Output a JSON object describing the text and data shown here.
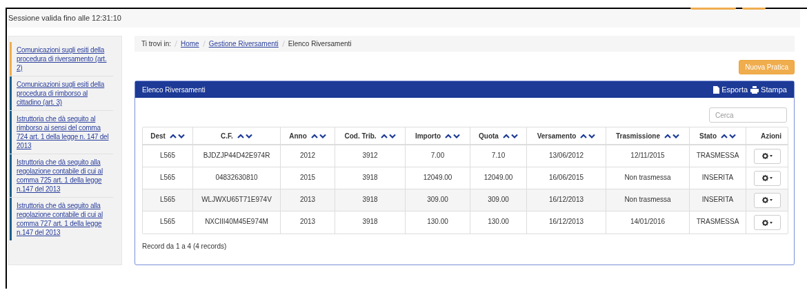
{
  "header": {
    "session": "Sessione valida fino alle 12:31:10"
  },
  "sidebar": {
    "items": [
      {
        "label": "Comunicazioni sugli esiti della procedura di riversamento (art. 2)",
        "selected": true
      },
      {
        "label": "Comunicazioni sugli esiti della procedura di rimborso al cittadino (art. 3)",
        "selected": false
      },
      {
        "label": "Istruttoria che dà seguito al rimborso ai sensi del comma 724 art. 1 della legge n. 147 del 2013",
        "selected": false
      },
      {
        "label": "Istruttoria che dà seguito alla regolazione contabile di cui al comma 725 art. 1 della legge n.147 del 2013",
        "selected": false
      },
      {
        "label": "Istruttoria che dà seguito alla regolazione contabile di cui al comma 727 art. 1 della legge n.147 del 2013",
        "selected": false
      }
    ]
  },
  "breadcrumb": {
    "prefix": "Ti trovi in:",
    "items": [
      {
        "label": "Home",
        "kind": "link"
      },
      {
        "label": "Gestione Riversamenti",
        "kind": "link"
      },
      {
        "label": "Elenco Riversamenti",
        "kind": "current"
      }
    ]
  },
  "new_button": "Nuova Pratica",
  "panel": {
    "title": "Elenco Riversamenti",
    "actions": [
      {
        "label": "Esporta",
        "kind": "export"
      },
      {
        "label": "Stampa",
        "kind": "print"
      }
    ],
    "search": {
      "placeholder": "Cerca"
    },
    "table": {
      "columns": [
        {
          "label": "Dest",
          "sortable": true
        },
        {
          "label": "C.F.",
          "sortable": true
        },
        {
          "label": "Anno",
          "sortable": true
        },
        {
          "label": "Cod. Trib.",
          "sortable": true
        },
        {
          "label": "Importo",
          "sortable": true
        },
        {
          "label": "Quota",
          "sortable": true
        },
        {
          "label": "Versamento",
          "sortable": true
        },
        {
          "label": "Trasmissione",
          "sortable": true
        },
        {
          "label": "Stato",
          "sortable": true
        },
        {
          "label": "Azioni",
          "sortable": false
        }
      ],
      "rows": [
        {
          "cells": [
            "L565",
            "BJDZJP44D42E974R",
            "2012",
            "3912",
            "7.00",
            "7.10",
            "13/06/2012",
            "12/11/2015",
            "TRASMESSA"
          ]
        },
        {
          "cells": [
            "L565",
            "04832630810",
            "2015",
            "3918",
            "12049.00",
            "12049.00",
            "16/06/2015",
            "Non trasmessa",
            "INSERITA"
          ]
        },
        {
          "cells": [
            "L565",
            "WLJWXU65T71E974V",
            "2013",
            "3918",
            "309.00",
            "309.00",
            "16/12/2013",
            "Non trasmessa",
            "INSERITA"
          ]
        },
        {
          "cells": [
            "L565",
            "NXCIII40M45E974M",
            "2013",
            "3918",
            "130.00",
            "130.00",
            "16/12/2013",
            "14/01/2016",
            "TRASMESSA"
          ]
        }
      ]
    },
    "footer": "Record da 1 a 4 (4 records)"
  }
}
